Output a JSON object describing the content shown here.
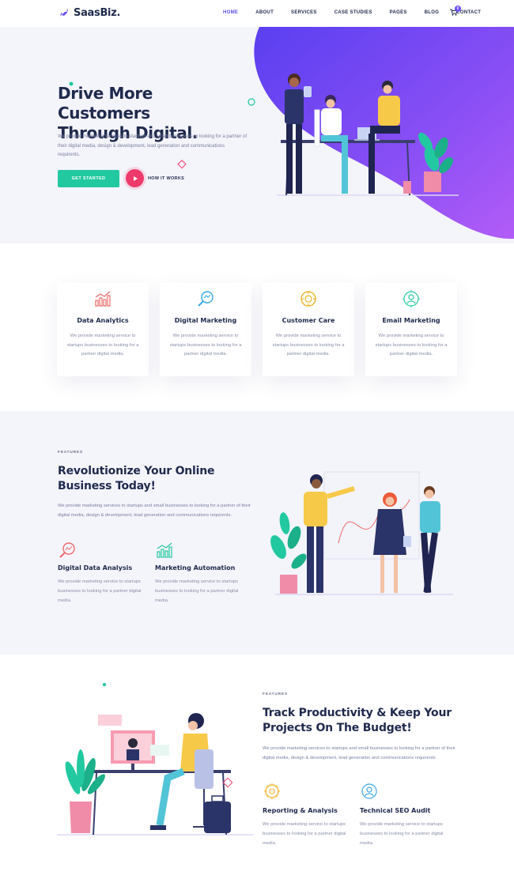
{
  "brand": {
    "logo_text": "SaasBiz."
  },
  "nav": {
    "items": [
      {
        "label": "HOME"
      },
      {
        "label": "ABOUT"
      },
      {
        "label": "SERVICES"
      },
      {
        "label": "CASE STUDIES"
      },
      {
        "label": "PAGES"
      },
      {
        "label": "BLOG"
      },
      {
        "label": "CONTACT"
      }
    ],
    "active": "HOME",
    "cart_count": "0"
  },
  "hero": {
    "title_line1": "Drive More Customers",
    "title_line2": "Through Digital.",
    "description": "We provide marketing services to startups and small businesses to looking for a partner of their digital media, design & development, lead generation and communications requirents.",
    "cta_label": "GET STARTED",
    "video_label": "HOW IT WORKS"
  },
  "services": {
    "cards": [
      {
        "title": "Data Analytics",
        "desc": "We provide marketing service to startups businesses to looking for a partner digital media.",
        "icon": "bar-chart-icon"
      },
      {
        "title": "Digital Marketing",
        "desc": "We provide marketing service to startups businesses to looking for a partner digital media.",
        "icon": "magnifier-icon"
      },
      {
        "title": "Customer Care",
        "desc": "We provide marketing service to startups businesses to looking for a partner digital media.",
        "icon": "gear-badge-icon"
      },
      {
        "title": "Email Marketing",
        "desc": "We provide marketing service to startups businesses to looking for a partner digital media.",
        "icon": "user-target-icon"
      }
    ]
  },
  "features1": {
    "eyebrow": "FEATURES",
    "title_line1": "Revolutionize Your Online",
    "title_line2": "Business Today!",
    "description": "We provide marketing services to startups and small businesses to looking for a partner of their digital media, design & development, lead generation and communications requirents.",
    "items": [
      {
        "title": "Digital Data Analysis",
        "desc": "We provide marketing service to startups businesses to looking for a partner digital media."
      },
      {
        "title": "Marketing Automation",
        "desc": "We provide marketing service to startups businesses to looking for a partner digital media."
      }
    ]
  },
  "features2": {
    "eyebrow": "FEATURES",
    "title_line1": "Track Productivity & Keep Your",
    "title_line2": "Projects On The Budget!",
    "description": "We provide marketing services to startups and small businesses to looking for a partner of their digital media, design & development, lead generation and communications requirents.",
    "items": [
      {
        "title": "Reporting & Analysis",
        "desc": "We provide marketing service to startups businesses to looking for a partner digital media."
      },
      {
        "title": "Technical SEO Audit",
        "desc": "We provide marketing service to startups businesses to looking for a partner digital media."
      }
    ]
  },
  "colors": {
    "primary": "#5b4cf0",
    "accent_green": "#22c9a0",
    "accent_pink": "#ee3a6b",
    "heading": "#1f2a4d",
    "muted": "#7a80a0",
    "section_bg": "#f4f4fb"
  }
}
